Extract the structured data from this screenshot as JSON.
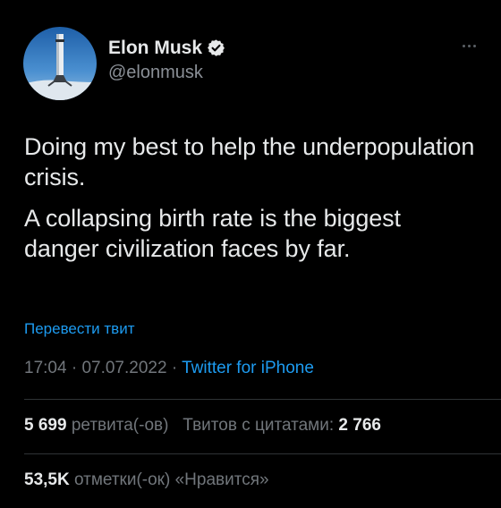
{
  "author": {
    "display_name": "Elon Musk",
    "handle": "@elonmusk",
    "verified": true
  },
  "tweet": {
    "paragraphs": [
      "Doing my best to help the underpopulation crisis.",
      "A collapsing birth rate is the biggest danger civilization faces by far."
    ],
    "translate_label": "Перевести твит",
    "time": "17:04",
    "date": "07.07.2022",
    "source": "Twitter for iPhone",
    "separator": "·"
  },
  "stats": {
    "retweets_count": "5 699",
    "retweets_label": "ретвита(-ов)",
    "quotes_label": "Твитов с цитатами:",
    "quotes_count": "2 766",
    "likes_count": "53,5K",
    "likes_label": "отметки(-ок) «Нравится»"
  },
  "colors": {
    "background": "#000000",
    "text": "#e7e9ea",
    "muted": "#71767b",
    "link": "#1d9bf0",
    "divider": "#2f3336"
  },
  "icons": {
    "verified": "verified-badge-icon",
    "more": "more-options-icon"
  }
}
